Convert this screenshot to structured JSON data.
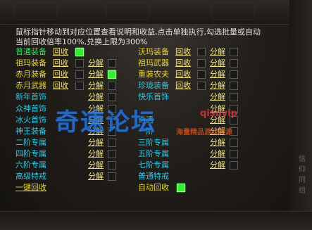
{
  "info": {
    "line1": "鼠标指针移动到对应位置查看说明和收益,点击单独执行,勾选批量或自动",
    "line2": "当前回收倍率100%,兑换上限为300%"
  },
  "actions": {
    "recycle": "回收",
    "decompose": "分解"
  },
  "left_rows": [
    {
      "label": "普通装备",
      "color": "#2fe05a",
      "recycle": true,
      "recycle_checked": true,
      "decompose": false
    },
    {
      "label": "祖玛装备",
      "color": "#e8d530",
      "recycle": true,
      "recycle_checked": false,
      "decompose": true,
      "decompose_checked": false
    },
    {
      "label": "赤月装备",
      "color": "#e8d530",
      "recycle": true,
      "recycle_checked": false,
      "decompose": true,
      "decompose_checked": true
    },
    {
      "label": "赤月武器",
      "color": "#e8d530",
      "recycle": true,
      "recycle_checked": false,
      "decompose": true,
      "decompose_checked": false
    },
    {
      "label": "新年首饰",
      "color": "#37c7e4",
      "recycle": false,
      "decompose": true,
      "decompose_checked": false
    },
    {
      "label": "众神首饰",
      "color": "#37c7e4",
      "recycle": false,
      "decompose": true,
      "decompose_checked": false
    },
    {
      "label": "冰火首饰",
      "color": "#37c7e4",
      "recycle": false,
      "decompose": true,
      "decompose_checked": false
    },
    {
      "label": "神王装备",
      "color": "#37c7e4",
      "recycle": false,
      "decompose": true,
      "decompose_checked": false
    },
    {
      "label": "二阶专属",
      "color": "#37c7e4",
      "recycle": false,
      "decompose": true,
      "decompose_checked": false
    },
    {
      "label": "四阶专属",
      "color": "#37c7e4",
      "recycle": false,
      "decompose": true,
      "decompose_checked": false
    },
    {
      "label": "六阶专属",
      "color": "#37c7e4",
      "recycle": false,
      "decompose": true,
      "decompose_checked": false
    },
    {
      "label": "高级特戒",
      "color": "#37c7e4",
      "recycle": false,
      "decompose": true,
      "decompose_checked": false
    }
  ],
  "right_rows": [
    {
      "label": "沃玛装备",
      "color": "#e8d530",
      "recycle": true,
      "recycle_checked": false,
      "decompose": true,
      "decompose_checked": false
    },
    {
      "label": "祖玛武器",
      "color": "#e8d530",
      "recycle": true,
      "recycle_checked": false,
      "decompose": true,
      "decompose_checked": false
    },
    {
      "label": "重装农夫",
      "color": "#e8d530",
      "recycle": true,
      "recycle_checked": false,
      "decompose": true,
      "decompose_checked": false
    },
    {
      "label": "珍珑装备",
      "color": "#37c7e4",
      "recycle": true,
      "recycle_checked": false,
      "decompose": true,
      "decompose_checked": false
    },
    {
      "label": "快乐首饰",
      "color": "#37c7e4",
      "recycle": false,
      "decompose": true,
      "decompose_checked": false
    },
    {
      "label": "",
      "color": "#37c7e4",
      "recycle": false,
      "decompose": true,
      "decompose_checked": false
    },
    {
      "label": "奇遇",
      "color": "#37c7e4",
      "recycle": false,
      "decompose": true,
      "decompose_checked": false
    },
    {
      "label": "一阶",
      "color": "#37c7e4",
      "recycle": false,
      "decompose": true,
      "decompose_checked": false
    },
    {
      "label": "三阶专属",
      "color": "#37c7e4",
      "recycle": false,
      "decompose": true,
      "decompose_checked": false
    },
    {
      "label": "五阶专属",
      "color": "#37c7e4",
      "recycle": false,
      "decompose": true,
      "decompose_checked": false
    },
    {
      "label": "七阶专属",
      "color": "#37c7e4",
      "recycle": false,
      "decompose": true,
      "decompose_checked": false
    },
    {
      "label": "普通特戒",
      "color": "#37c7e4",
      "recycle": false,
      "decompose": false
    }
  ],
  "one_click": "一键回收",
  "auto_recycle": {
    "label": "自动回收",
    "checked": true
  },
  "watermark": {
    "main": "奇速论坛",
    "site": "qisuvip",
    "sub": "海量精品游戏资源"
  },
  "side_labels": [
    "信仰",
    "同组"
  ]
}
